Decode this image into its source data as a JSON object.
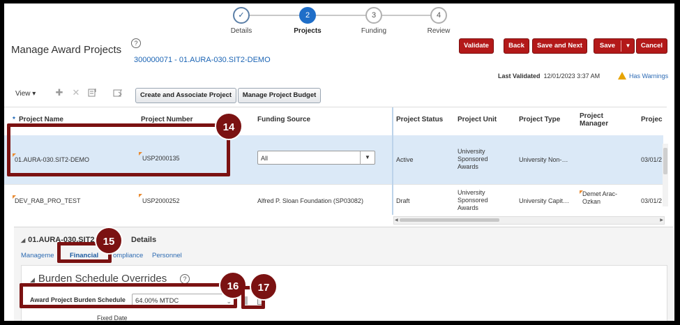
{
  "train": {
    "steps": [
      {
        "number": "✓",
        "label": "Details",
        "state": "done"
      },
      {
        "number": "2",
        "label": "Projects",
        "state": "current"
      },
      {
        "number": "3",
        "label": "Funding",
        "state": "todo"
      },
      {
        "number": "4",
        "label": "Review",
        "state": "todo"
      }
    ]
  },
  "header": {
    "title": "Manage Award Projects",
    "award_link": "300000071 - 01.AURA-030.SIT2-DEMO",
    "help_glyph": "?"
  },
  "actions": {
    "validate": "Validate",
    "back": "Back",
    "save_next": "Save and Next",
    "save": "Save",
    "save_arrow": "▼",
    "cancel": "Cancel"
  },
  "status": {
    "last_validated_label": "Last Validated",
    "last_validated_value": "12/01/2023 3:37 AM",
    "warnings": "Has Warnings"
  },
  "toolbar": {
    "view": "View ▾",
    "add_glyph": "✚",
    "delete_glyph": "✕",
    "create_assoc": "Create and Associate Project",
    "manage_budget": "Manage Project Budget"
  },
  "table": {
    "headers": {
      "required_mark": "*",
      "project_name": "Project Name",
      "project_number": "Project Number",
      "funding_source": "Funding Source",
      "project_status": "Project Status",
      "project_unit": "Project Unit",
      "project_type": "Project Type",
      "project_manager": "Project Manager",
      "project_more": "Projec"
    },
    "rows": [
      {
        "name": "01.AURA-030.SIT2-DEMO",
        "number": "USP2000135",
        "funding": "All",
        "status": "Active",
        "unit": "University Sponsored Awards",
        "type": "University Non-…",
        "manager": "",
        "date": "03/01/2"
      },
      {
        "name": "DEV_RAB_PRO_TEST",
        "number": "USP2000252",
        "funding": "Alfred P. Sloan Foundation (SP03082)",
        "status": "Draft",
        "unit": "University Sponsored Awards",
        "type": "University Capit…",
        "manager": "Demet Arac-Ozkan",
        "date": "03/01/2"
      }
    ]
  },
  "details": {
    "title": "01.AURA-030.SIT2",
    "title_suffix": "Details",
    "tabs": [
      "Manageme",
      "Financial",
      "ompliance",
      "Personnel"
    ],
    "section_title": "Burden Schedule Overrides",
    "field_label": "Award Project Burden Schedule",
    "field_value": "64.00% MTDC",
    "fixed_date": "Fixed Date"
  },
  "callouts": [
    "14",
    "15",
    "16",
    "17"
  ],
  "colors": {
    "accent_red": "#b31919",
    "callout": "#7b1212",
    "link": "#1b64b4",
    "train_active": "#1f6ec8"
  }
}
